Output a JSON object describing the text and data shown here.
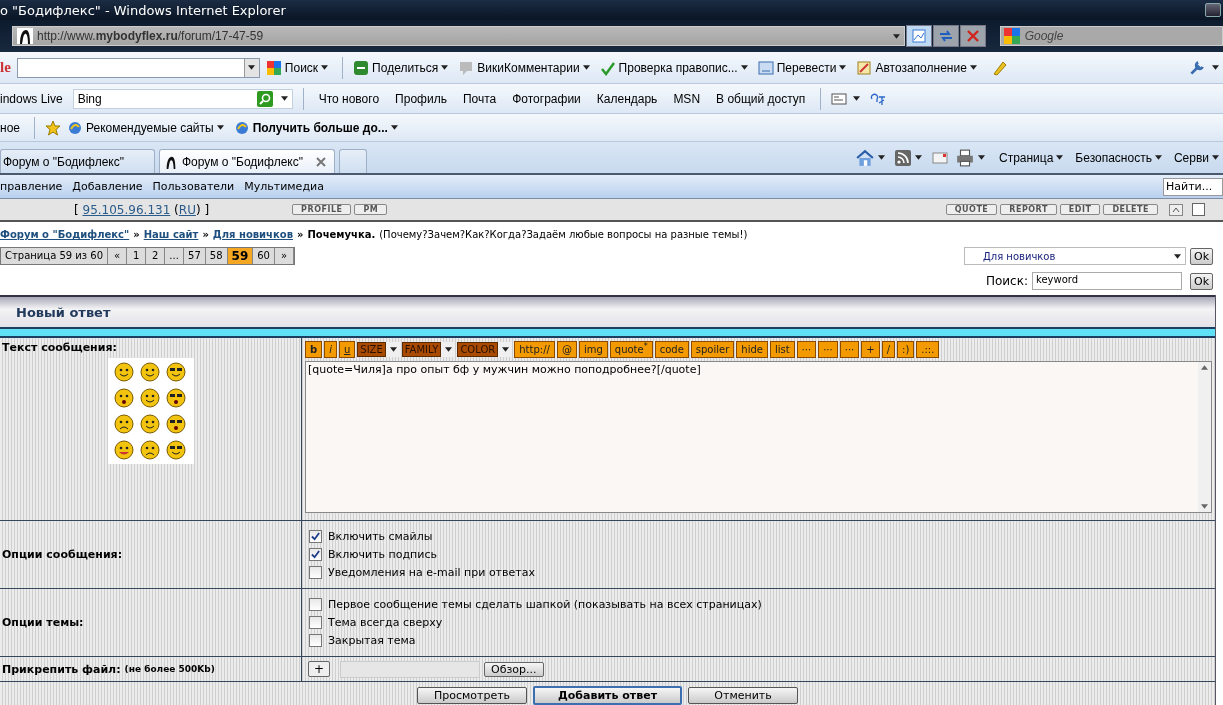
{
  "window": {
    "title": "о \"Бодифлекс\" - Windows Internet Explorer"
  },
  "address_bar": {
    "url": "http://www.**mybodyflex.ru**/forum/17-47-59",
    "search_placeholder": "Google"
  },
  "google_toolbar": {
    "logo_fragment": "le",
    "items": [
      "Поиск",
      "Поделиться",
      "ВикиКомментарии",
      "Проверка правопис...",
      "Перевести",
      "Автозаполнение"
    ]
  },
  "live_toolbar": {
    "brand_fragment": "indows Live",
    "search_value": "Bing",
    "links": [
      "Что нового",
      "Профиль",
      "Почта",
      "Фотографии",
      "Календарь",
      "MSN",
      "В общий доступ"
    ]
  },
  "favorites_bar": {
    "fragment": "ное",
    "items": [
      {
        "label": "Рекомендуемые сайты",
        "kind": "plain"
      },
      {
        "label": "Получить больше до...",
        "kind": "bold"
      }
    ]
  },
  "tabs": [
    {
      "label": "Форум о \"Бодифлекс\"",
      "selected": false
    },
    {
      "label": "Форум о \"Бодифлекс\"",
      "selected": true
    }
  ],
  "command_bar": [
    "Страница",
    "Безопасность",
    "Серви"
  ],
  "admin_menu": {
    "items": [
      "правление",
      "Добавление",
      "Пользователи",
      "Мультимедиа"
    ],
    "find_placeholder": "Найти..."
  },
  "post_bar": {
    "selected": false,
    "ip_open": "[",
    "ip": "95.105.96.131",
    "country_open": "(",
    "country": "RU",
    "ip_close": ") ]",
    "left_buttons": [
      "PROFILE",
      "PM"
    ],
    "right_buttons": [
      "QUOTE",
      "REPORT",
      "EDIT",
      "DELETE"
    ]
  },
  "breadcrumb": {
    "links": [
      "Форум о \"Бодифлекс\"",
      "Наш сайт",
      "Для новичков"
    ],
    "separator": "»",
    "topic": "Почемучка.",
    "description": "(Почему?Зачем?Как?Когда?Задаём любые вопросы на разные темы!)"
  },
  "pagination": {
    "label": "Страница 59 из 60",
    "items": [
      {
        "label": "«",
        "selected": false
      },
      {
        "label": "1",
        "selected": false
      },
      {
        "label": "2",
        "selected": false
      },
      {
        "label": "...",
        "selected": false
      },
      {
        "label": "57",
        "selected": false
      },
      {
        "label": "58",
        "selected": false
      },
      {
        "label": "59",
        "selected": true
      },
      {
        "label": "60",
        "selected": false
      },
      {
        "label": "»",
        "selected": false
      }
    ]
  },
  "forum_jump": {
    "value": "Для новичков",
    "button": "Ok"
  },
  "search": {
    "label": "Поиск:",
    "value": "keyword",
    "button": "Ok"
  },
  "reply_form": {
    "title": "Новый ответ",
    "message_label": "Текст сообщения:",
    "toolbar": [
      {
        "label": "b",
        "kind": "bold"
      },
      {
        "label": "i",
        "kind": "italic"
      },
      {
        "label": "u",
        "kind": "underline"
      },
      {
        "label": "SIZE",
        "kind": "select"
      },
      {
        "label": "FAMILY",
        "kind": "select"
      },
      {
        "label": "COLOR",
        "kind": "select"
      },
      {
        "label": "http://",
        "kind": "tag"
      },
      {
        "label": "@",
        "kind": "tag"
      },
      {
        "label": "img",
        "kind": "tag"
      },
      {
        "label": "quote$^{*}$",
        "kind": "tag"
      },
      {
        "label": "code",
        "kind": "tag"
      },
      {
        "label": "spoiler",
        "kind": "tag"
      },
      {
        "label": "hide",
        "kind": "tag"
      },
      {
        "label": "list",
        "kind": "tag"
      },
      {
        "label": "···",
        "kind": "tag"
      },
      {
        "label": "···",
        "kind": "tag"
      },
      {
        "label": "···",
        "kind": "tag"
      },
      {
        "label": "+",
        "kind": "tag"
      },
      {
        "label": "/",
        "kind": "tag"
      },
      {
        "label": ":)",
        "kind": "tag"
      },
      {
        "label": ".::.",
        "kind": "tag"
      }
    ],
    "message": "[quote=Чиля]а про опыт бф у мужчин можно поподробнее?[/quote]",
    "message_options": {
      "label": "Опции сообщения:",
      "options": [
        {
          "label": "Включить смайлы",
          "checked": true
        },
        {
          "label": "Включить подпись",
          "checked": true
        },
        {
          "label": "Уведомления на e-mail при ответах",
          "checked": false
        }
      ]
    },
    "topic_options": {
      "label": "Опции темы:",
      "options": [
        {
          "label": "Первое сообщение темы сделать шапкой (показывать на всех страницах)",
          "checked": false
        },
        {
          "label": "Тема всегда сверху",
          "checked": false
        },
        {
          "label": "Закрытая тема",
          "checked": false
        }
      ]
    },
    "attach": {
      "label": "Прикрепить файл:",
      "note": "(не более 500Kb)",
      "add": "+",
      "browse": "Обзор..."
    },
    "buttons": [
      {
        "label": "Просмотреть",
        "default": false
      },
      {
        "label": "Добавить ответ",
        "default": true
      },
      {
        "label": "Отменить",
        "default": false
      }
    ]
  }
}
